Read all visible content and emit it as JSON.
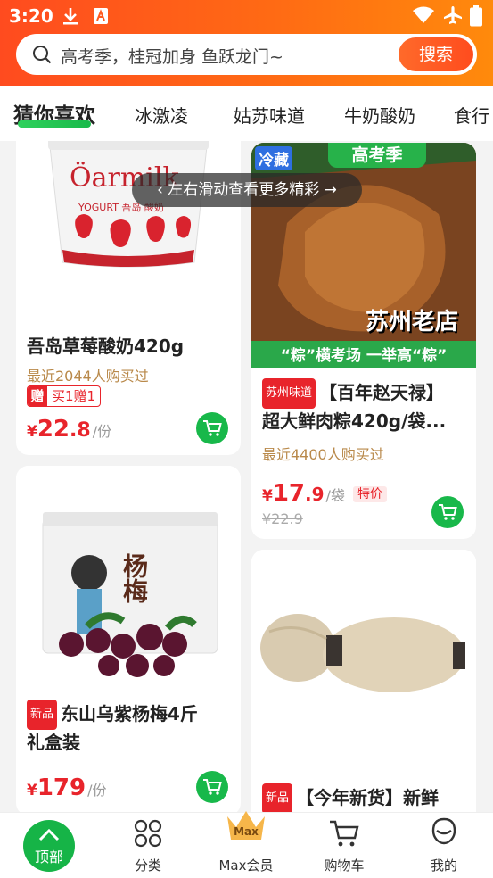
{
  "status_bar": {
    "time": "3:20"
  },
  "search": {
    "placeholder": "高考季，桂冠加身 鱼跃龙门~",
    "button": "搜索"
  },
  "tabs": [
    "猜你喜欢",
    "冰激凌",
    "姑苏味道",
    "牛奶酸奶",
    "食行"
  ],
  "toast": "左右滑动查看更多精彩",
  "products": {
    "p1": {
      "title": "吾岛草莓酸奶420g",
      "sold": "最近2044人购买过",
      "promo_icon": "赠",
      "promo_text": "买1赠1",
      "price_currency": "¥",
      "price_int": "22",
      "price_dec": ".8",
      "unit": "/份",
      "image_text": {
        "brand": "Öarmilk",
        "sub": "YOGURT 吾岛 酸奶"
      }
    },
    "p2": {
      "badge_cold": "冷藏",
      "banner_top": "高考季",
      "overlay": "苏州老店",
      "slogan": "“粽”横考场 一举高“粽”",
      "tag": "苏州味道",
      "title_line1": "【百年赵天禄】",
      "title_line2": "超大鲜肉粽420g/袋...",
      "sold": "最近4400人购买过",
      "price_currency": "¥",
      "price_int": "17",
      "price_dec": ".9",
      "unit": "/袋",
      "special": "特价",
      "orig_price": "¥22.9"
    },
    "p3": {
      "tag": "新品",
      "title_line1": "东山乌紫杨梅4斤",
      "title_line2": "礼盒装",
      "price_currency": "¥",
      "price_int": "179",
      "unit": "/份",
      "image_text": "杨梅"
    },
    "p4": {
      "tag": "新品",
      "title_line1": "【今年新货】新鲜"
    }
  },
  "bottom_nav": {
    "top": "顶部",
    "category": "分类",
    "max_badge": "Max",
    "member": "Max会员",
    "cart": "购物车",
    "mine": "我的"
  },
  "colors": {
    "accent": "#ff5a1f",
    "green": "#18b84a",
    "price": "#e8242b"
  }
}
